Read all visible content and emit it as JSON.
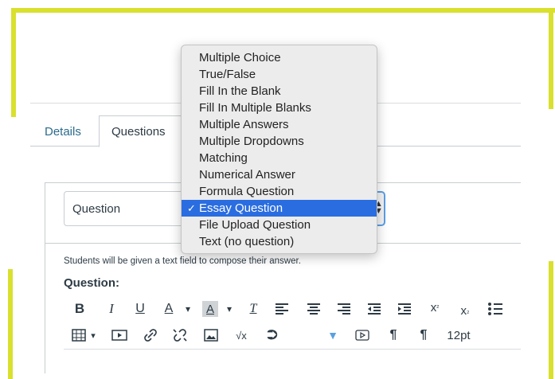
{
  "tabs": [
    {
      "label": "Details",
      "active": false
    },
    {
      "label": "Questions",
      "active": true
    }
  ],
  "question": {
    "name_value": "Question",
    "hint": "Students will be given a text field to compose their answer.",
    "label": "Question:"
  },
  "dropdown": {
    "options": [
      "Multiple Choice",
      "True/False",
      "Fill In the Blank",
      "Fill In Multiple Blanks",
      "Multiple Answers",
      "Multiple Dropdowns",
      "Matching",
      "Numerical Answer",
      "Formula Question",
      "Essay Question",
      "File Upload Question",
      "Text (no question)"
    ],
    "selected": "Essay Question",
    "check_glyph": "✓"
  },
  "toolbar": {
    "bold": "B",
    "italic": "I",
    "underline": "U",
    "text_color": "A",
    "bg_color": "A",
    "dropdown_caret": "▾",
    "clear_format": "T",
    "font_size": "12pt"
  },
  "colors": {
    "accent": "#2a6de0",
    "frame_yellow": "#d9e02e",
    "link": "#2b6c8c"
  }
}
